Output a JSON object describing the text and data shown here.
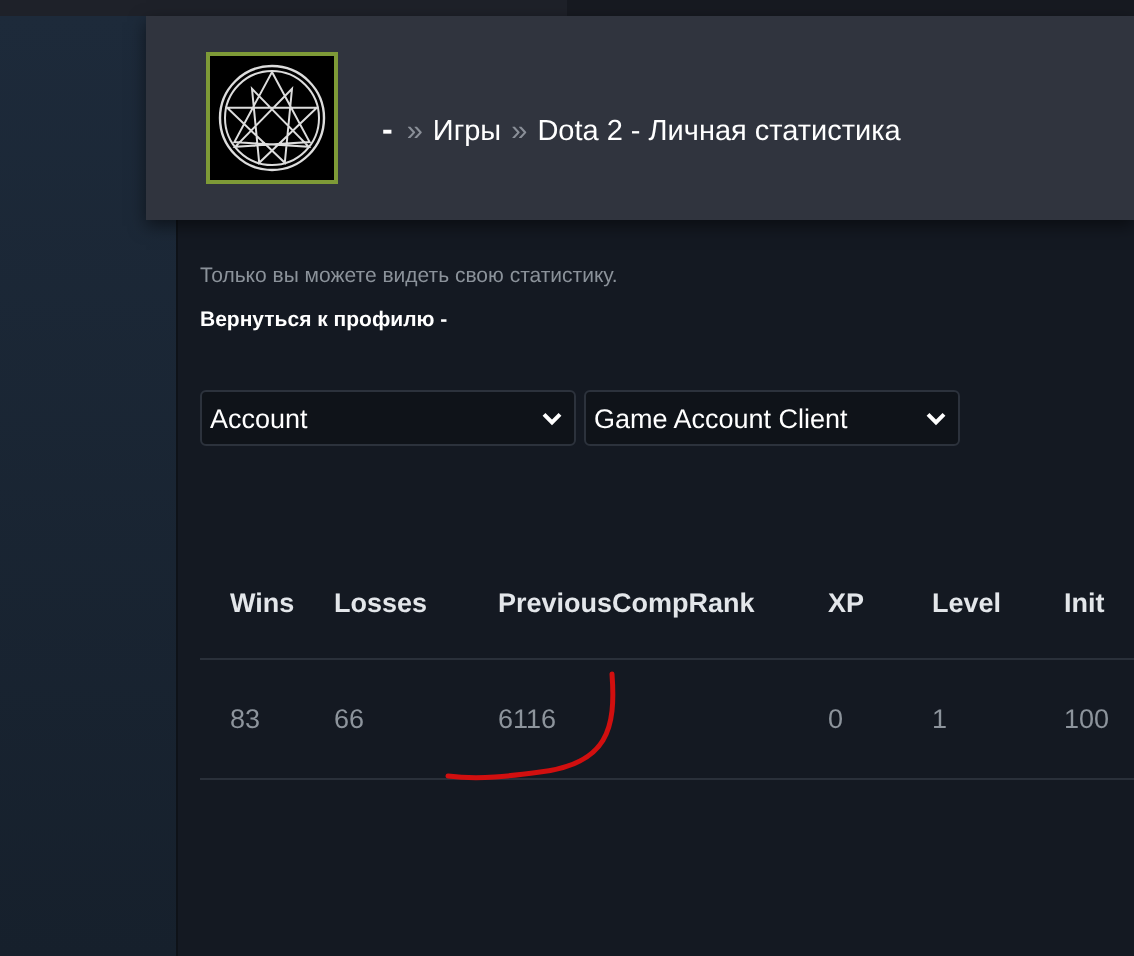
{
  "breadcrumb": {
    "user": "-",
    "items": [
      {
        "separator": "»",
        "label": "Игры"
      },
      {
        "separator": "»",
        "label": "Dota 2 - Личная статистика"
      }
    ]
  },
  "notice": "Только вы можете видеть свою статистику.",
  "back_link": "Вернуться к профилю -",
  "selects": [
    {
      "value": "Account"
    },
    {
      "value": "Game Account Client"
    }
  ],
  "table": {
    "columns": [
      "Wins",
      "Losses",
      "PreviousCompRank",
      "XP",
      "Level",
      "Init"
    ],
    "rows": [
      [
        "83",
        "66",
        "6116",
        "0",
        "1",
        "100"
      ]
    ]
  }
}
